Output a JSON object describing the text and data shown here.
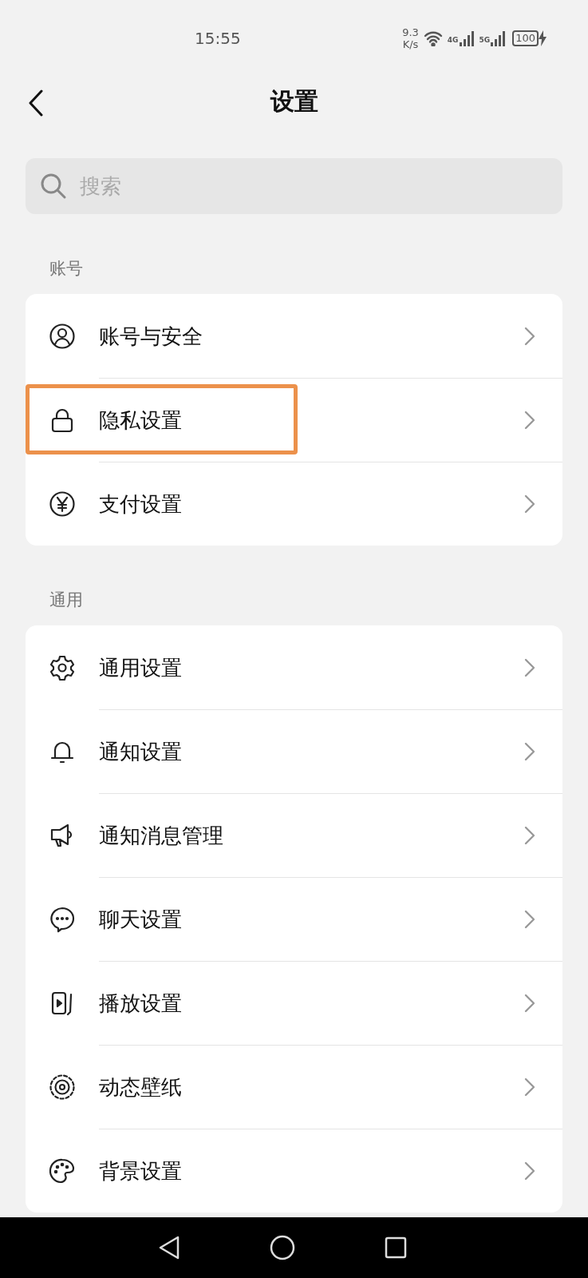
{
  "status_bar": {
    "time": "15:55",
    "speed_value": "9.3",
    "speed_unit": "K/s",
    "network_1": "4G",
    "network_2": "5G",
    "battery": "100",
    "charging": true
  },
  "header": {
    "title": "设置"
  },
  "search": {
    "placeholder": "搜索"
  },
  "sections": [
    {
      "title": "账号",
      "items": [
        {
          "label": "账号与安全",
          "highlighted": false
        },
        {
          "label": "隐私设置",
          "highlighted": true
        },
        {
          "label": "支付设置",
          "highlighted": false
        }
      ]
    },
    {
      "title": "通用",
      "items": [
        {
          "label": "通用设置",
          "highlighted": false
        },
        {
          "label": "通知设置",
          "highlighted": false
        },
        {
          "label": "通知消息管理",
          "highlighted": false
        },
        {
          "label": "聊天设置",
          "highlighted": false
        },
        {
          "label": "播放设置",
          "highlighted": false
        },
        {
          "label": "动态壁纸",
          "highlighted": false
        },
        {
          "label": "背景设置",
          "highlighted": false
        }
      ]
    }
  ]
}
